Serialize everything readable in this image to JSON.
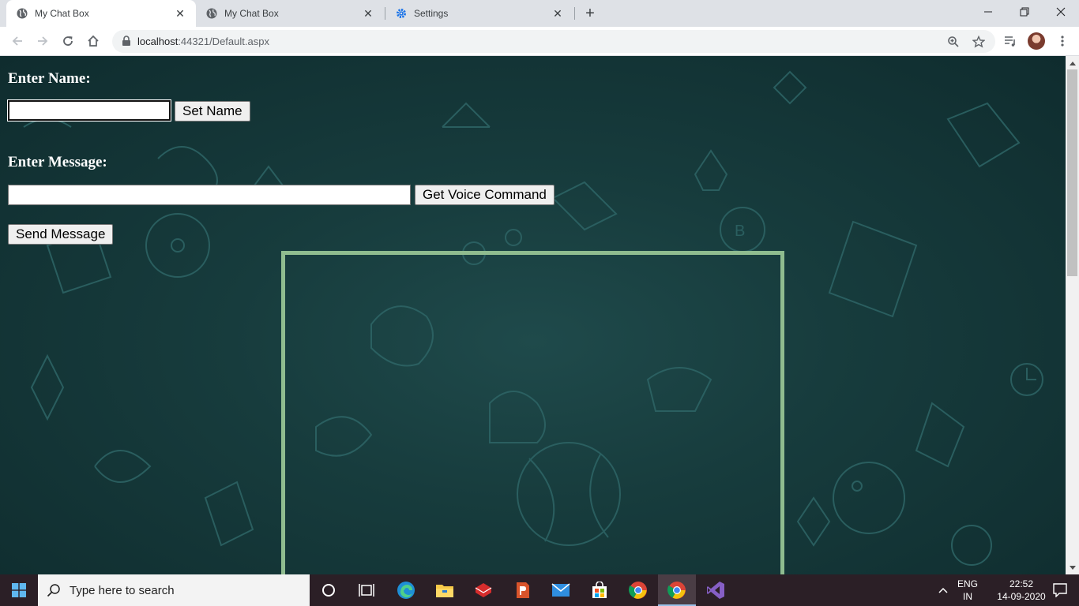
{
  "browser": {
    "tabs": [
      {
        "title": "My Chat Box",
        "active": true,
        "icon": "globe-icon"
      },
      {
        "title": "My Chat Box",
        "active": false,
        "icon": "globe-icon"
      },
      {
        "title": "Settings",
        "active": false,
        "icon": "gear-icon"
      }
    ],
    "new_tab_symbol": "+",
    "close_symbol": "✕",
    "url_host": "localhost",
    "url_rest": ":44321/Default.aspx"
  },
  "form": {
    "name_label": "Enter Name:",
    "name_value": "",
    "set_name_button": "Set Name",
    "message_label": "Enter Message:",
    "message_value": "",
    "voice_button": "Get Voice Command",
    "send_button": "Send Message"
  },
  "colors": {
    "page_background": "#173c3d",
    "panel_border": "#8fbc8f",
    "taskbar": "#2b1f26"
  },
  "taskbar": {
    "search_placeholder": "Type here to search",
    "apps": [
      "cortana-icon",
      "task-view-icon",
      "edge-icon",
      "file-explorer-icon",
      "ruby-app-icon",
      "office-app-icon",
      "mail-icon",
      "store-icon",
      "chrome-icon",
      "chrome-active-icon",
      "visual-studio-icon"
    ],
    "lang_line1": "ENG",
    "lang_line2": "IN",
    "time": "22:52",
    "date": "14-09-2020"
  }
}
